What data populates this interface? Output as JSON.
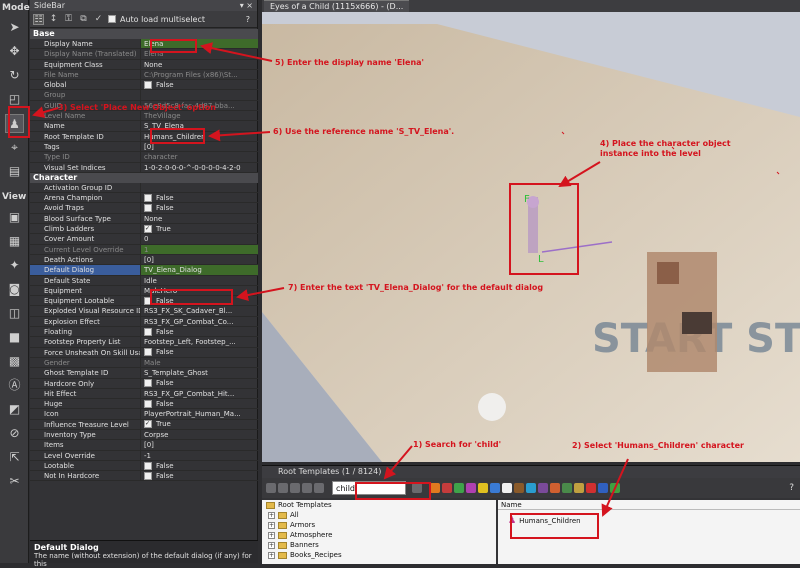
{
  "mode_bar": {
    "title": "Mode",
    "view_title": "View"
  },
  "sidebar": {
    "title": "SideBar",
    "pin": "▾ ×",
    "auto_load_label": "Auto load multiselect",
    "help_glyph": "?",
    "sections": [
      {
        "name": "Base",
        "rows": [
          {
            "n": "Display Name",
            "v": "Elena",
            "cls": "green"
          },
          {
            "n": "Display Name (Translated)",
            "v": "Elena",
            "cls": "dis"
          },
          {
            "n": "Equipment Class",
            "v": "None"
          },
          {
            "n": "File Name",
            "v": "C:\\Program Files (x86)\\St...",
            "cls": "dis"
          },
          {
            "n": "Global",
            "v": "False",
            "chk": true
          },
          {
            "n": "Group",
            "v": "",
            "cls": "dis"
          },
          {
            "n": "GUID",
            "v": "56e8d5c8-fac-4d87-bba...",
            "cls": "dis"
          },
          {
            "n": "Level Name",
            "v": "TheVillage",
            "cls": "dis"
          },
          {
            "n": "Name",
            "v": "S_TV_Elena"
          },
          {
            "n": "Root Template ID",
            "v": "Humans_Children"
          },
          {
            "n": "Tags",
            "v": "[0]"
          },
          {
            "n": "Type ID",
            "v": "character",
            "cls": "dis"
          },
          {
            "n": "Visual Set Indices",
            "v": "1-0-2-0-0-0-^-0-0-0-0-4-2-0"
          }
        ]
      },
      {
        "name": "Character",
        "rows": [
          {
            "n": "Activation Group ID",
            "v": ""
          },
          {
            "n": "Arena Champion",
            "v": "False",
            "chk": true
          },
          {
            "n": "Avoid Traps",
            "v": "False",
            "chk": true
          },
          {
            "n": "Blood Surface Type",
            "v": "None"
          },
          {
            "n": "Climb Ladders",
            "v": "True",
            "chk": true
          },
          {
            "n": "Cover Amount",
            "v": "0"
          },
          {
            "n": "Current Level Override",
            "v": "1",
            "cls": "dis green"
          },
          {
            "n": "Death Actions",
            "v": "[0]"
          },
          {
            "n": "Default Dialog",
            "v": "TV_Elena_Dialog",
            "cls": "selrow green"
          },
          {
            "n": "Default State",
            "v": "Idle"
          },
          {
            "n": "Equipment",
            "v": "MaleHero"
          },
          {
            "n": "Equipment Lootable",
            "v": "False",
            "chk": true
          },
          {
            "n": "Exploded Visual Resource ID",
            "v": "RS3_FX_SK_Cadaver_Bl..."
          },
          {
            "n": "Explosion Effect",
            "v": "RS3_FX_GP_Combat_Co..."
          },
          {
            "n": "Floating",
            "v": "False",
            "chk": true
          },
          {
            "n": "Footstep Property List",
            "v": "Footstep_Left, Footstep_..."
          },
          {
            "n": "Force Unsheath On Skill Usage",
            "v": "False",
            "chk": true
          },
          {
            "n": "Gender",
            "v": "Male",
            "cls": "dis"
          },
          {
            "n": "Ghost Template ID",
            "v": "S_Template_Ghost"
          },
          {
            "n": "Hardcore Only",
            "v": "False",
            "chk": true
          },
          {
            "n": "Hit Effect",
            "v": "RS3_FX_GP_Combat_Hit..."
          },
          {
            "n": "Huge",
            "v": "False",
            "chk": true
          },
          {
            "n": "Icon",
            "v": "PlayerPortrait_Human_Ma..."
          },
          {
            "n": "Influence Treasure Level",
            "v": "True",
            "chk": true
          },
          {
            "n": "Inventory Type",
            "v": "Corpse"
          },
          {
            "n": "Items",
            "v": "[0]"
          },
          {
            "n": "Level Override",
            "v": "-1"
          },
          {
            "n": "Lootable",
            "v": "False",
            "chk": true
          },
          {
            "n": "Not In Hardcore",
            "v": "False",
            "chk": true
          }
        ]
      }
    ],
    "help_title": "Default Dialog",
    "help_text": "The name (without extension) of the default dialog (if any) for this"
  },
  "viewport": {
    "tab_label": "Eyes of a Child (1115x666) - (D..."
  },
  "root_templates": {
    "title": "Root Templates (1 / 8124)",
    "search_value": "child",
    "list_header": "Name",
    "result": "Humans_Children",
    "tree": [
      "Root Templates",
      "All",
      "Armors",
      "Atmosphere",
      "Banners",
      "Books_Recipes"
    ]
  },
  "annotations": {
    "a1": "1) Search for 'child'",
    "a2": "2) Select 'Humans_Children' character",
    "a3": "3) Select 'Place New Object' option",
    "a4": "4) Place the character object instance into the level",
    "a5": "5) Enter the display name 'Elena'",
    "a6": "6) Use the reference name 'S_TV_Elena'.",
    "a7": "7) Enter the text 'TV_Elena_Dialog' for the default dialog"
  },
  "colors": {
    "accent_red": "#d4141e",
    "selection_blue": "#3a5d9c",
    "green_value": "#3e6b2a"
  }
}
